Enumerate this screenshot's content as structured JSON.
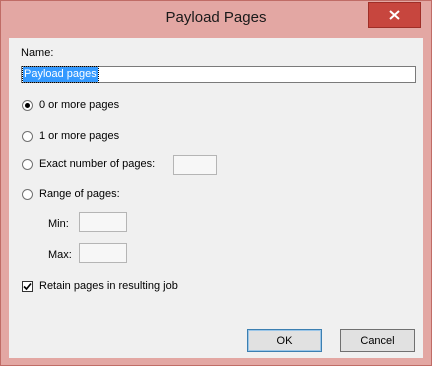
{
  "dialog": {
    "title": "Payload Pages",
    "close_icon": "close-x-icon"
  },
  "name": {
    "label": "Name:",
    "value": "Payload pages"
  },
  "options": [
    {
      "label": "0 or more pages",
      "checked": true
    },
    {
      "label": "1 or more pages",
      "checked": false
    },
    {
      "label": "Exact number of pages:",
      "checked": false
    },
    {
      "label": "Range of pages:",
      "checked": false
    }
  ],
  "range": {
    "min_label": "Min:",
    "max_label": "Max:"
  },
  "retain": {
    "label": "Retain pages in resulting job",
    "checked": true
  },
  "buttons": {
    "ok": "OK",
    "cancel": "Cancel"
  },
  "colors": {
    "frame": "#e3a7a3",
    "close_button": "#c7463e",
    "selection": "#3399ff"
  }
}
